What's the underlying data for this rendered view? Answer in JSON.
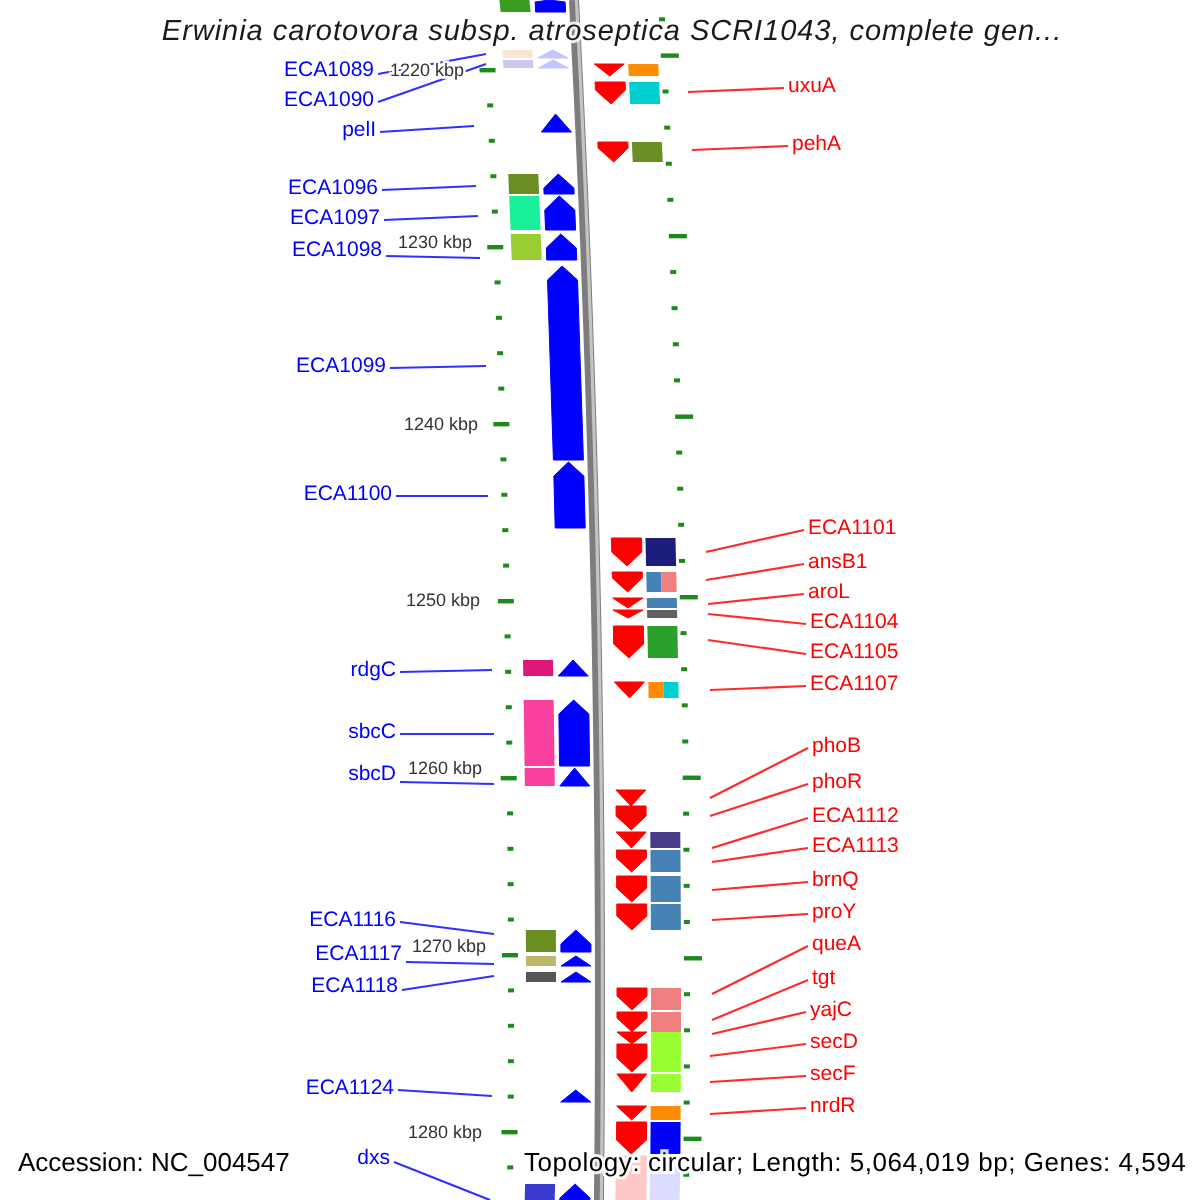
{
  "title": "Erwinia carotovora subsp. atroseptica SCRI1043, complete gen...",
  "scale_labels": [
    "1220 kbp",
    "1230 kbp",
    "1240 kbp",
    "1250 kbp",
    "1260 kbp",
    "1270 kbp",
    "1280 kbp"
  ],
  "forward_strand": {
    "genes": [
      {
        "cog": [
          {
            "color": "#3a9d23"
          }
        ]
      },
      {
        "label": "ECA1089",
        "cog": [
          {
            "color": "#fbe6d4"
          }
        ]
      },
      {
        "label": "ECA1090",
        "cog": [
          {
            "color": "#cdc8ea"
          }
        ]
      },
      {
        "label": "pelI"
      },
      {
        "label": "ECA1096",
        "cog": [
          {
            "color": "#6b8e23"
          }
        ]
      },
      {
        "label": "ECA1097",
        "cog": [
          {
            "color": "#1aef9b"
          }
        ]
      },
      {
        "label": "ECA1098",
        "cog": [
          {
            "color": "#9acd32"
          }
        ]
      },
      {
        "label": "ECA1099"
      },
      {
        "label": "ECA1100"
      },
      {
        "label": "rdgC",
        "cog": [
          {
            "color": "#e0177a"
          }
        ]
      },
      {
        "label": "sbcC",
        "cog": [
          {
            "color": "#f9409e"
          }
        ]
      },
      {
        "label": "sbcD",
        "cog": [
          {
            "color": "#f9409e"
          }
        ]
      },
      {
        "label": "ECA1116",
        "cog": [
          {
            "color": "#6b8e23"
          }
        ]
      },
      {
        "label": "ECA1117",
        "cog": [
          {
            "color": "#bdb76b"
          }
        ]
      },
      {
        "label": "ECA1118",
        "cog": [
          {
            "color": "#555555"
          }
        ]
      },
      {
        "label": "ECA1124"
      },
      {
        "label": "dxs",
        "cog": [
          {
            "color": "#3a3ad0"
          }
        ]
      }
    ]
  },
  "reverse_strand": {
    "genes": [
      {
        "cog": [
          {
            "color": "#ff8c00"
          }
        ]
      },
      {
        "label": "uxuA",
        "cog": [
          {
            "color": "#00ced1"
          }
        ]
      },
      {
        "label": "pehA",
        "cog": [
          {
            "color": "#6b8e23"
          }
        ]
      },
      {
        "label": "ECA1101",
        "cog": [
          {
            "color": "#1c1c7c"
          }
        ]
      },
      {
        "label": "ansB1",
        "cog": [
          {
            "color": "#4682b4"
          },
          {
            "color": "#f08080"
          }
        ]
      },
      {
        "label": "aroL",
        "cog": [
          {
            "color": "#4682b4"
          }
        ]
      },
      {
        "label": "ECA1104",
        "cog": [
          {
            "color": "#606060"
          }
        ]
      },
      {
        "label": "ECA1105",
        "cog": [
          {
            "color": "#2ca02c"
          }
        ]
      },
      {
        "label": "ECA1107",
        "cog": [
          {
            "color": "#ff8c00"
          },
          {
            "color": "#00ced1"
          }
        ]
      },
      {
        "label": "phoB"
      },
      {
        "label": "phoR"
      },
      {
        "label": "ECA1112",
        "cog": [
          {
            "color": "#483d8b"
          }
        ]
      },
      {
        "label": "ECA1113",
        "cog": [
          {
            "color": "#4682b4"
          }
        ]
      },
      {
        "label": "brnQ",
        "cog": [
          {
            "color": "#4682b4"
          }
        ]
      },
      {
        "label": "proY",
        "cog": [
          {
            "color": "#4682b4"
          }
        ]
      },
      {
        "label": "queA",
        "cog": [
          {
            "color": "#f08080"
          }
        ]
      },
      {
        "label": "tgt",
        "cog": [
          {
            "color": "#f08080"
          }
        ]
      },
      {
        "label": "yajC",
        "cog": [
          {
            "color": "#9aff32"
          }
        ]
      },
      {
        "label": "secD",
        "cog": [
          {
            "color": "#9aff32"
          }
        ]
      },
      {
        "label": "secF",
        "cog": [
          {
            "color": "#9aff32"
          }
        ]
      },
      {
        "label": "nrdR",
        "cog": [
          {
            "color": "#ff8c00"
          }
        ]
      },
      {
        "cog": [
          {
            "color": "#0000ff"
          }
        ]
      },
      {
        "cog": [
          {
            "color": "#dcdcff"
          }
        ]
      }
    ]
  },
  "accession": "Accession: NC_004547",
  "summary": "Topology: circular; Length: 5,064,019 bp; Genes: 4,594"
}
